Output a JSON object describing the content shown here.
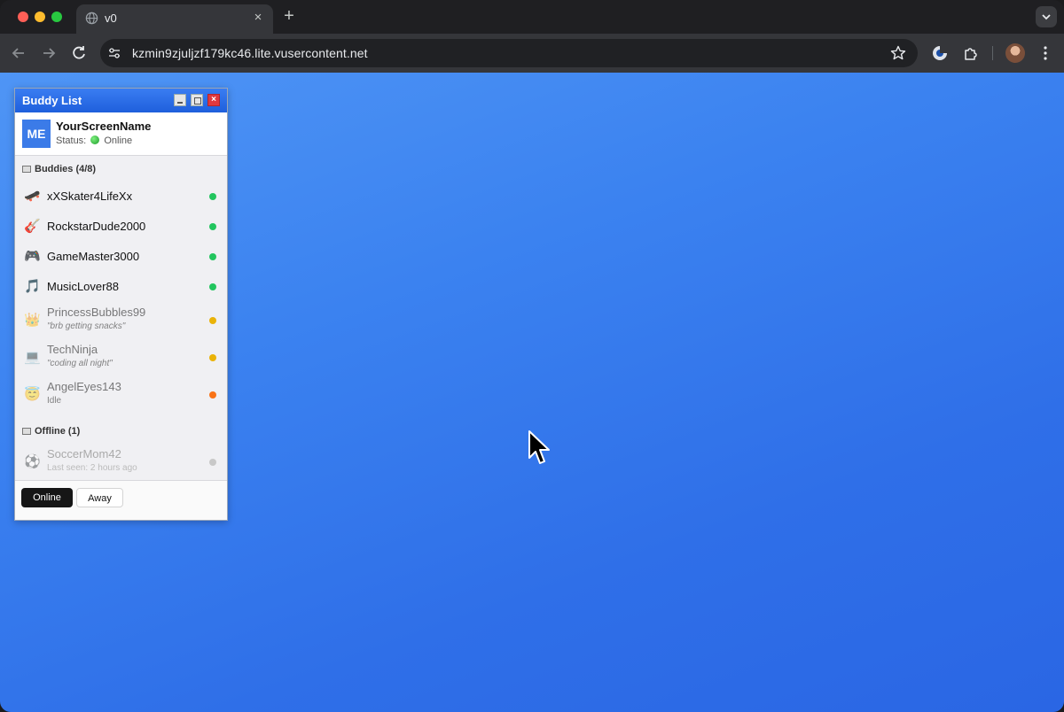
{
  "browser": {
    "tab_title": "v0",
    "tab_close": "×",
    "new_tab": "+",
    "url": "kzmin9zjuljzf179kc46.lite.vusercontent.net"
  },
  "buddy_list": {
    "title": "Buddy List",
    "close_label": "×",
    "me": {
      "avatar": "ME",
      "screen_name": "YourScreenName",
      "status_prefix": "Status:",
      "status": "Online"
    },
    "groups": {
      "buddies_label": "Buddies (4/8)",
      "offline_label": "Offline (1)"
    },
    "buddies": [
      {
        "emoji": "🛹",
        "name": "xXSkater4LifeXx",
        "status": "online",
        "color": "#22c55e"
      },
      {
        "emoji": "🎸",
        "name": "RockstarDude2000",
        "status": "online",
        "color": "#22c55e"
      },
      {
        "emoji": "🎮",
        "name": "GameMaster3000",
        "status": "online",
        "color": "#22c55e"
      },
      {
        "emoji": "🎵",
        "name": "MusicLover88",
        "status": "online",
        "color": "#22c55e"
      },
      {
        "emoji": "👑",
        "name": "PrincessBubbles99",
        "message": "\"brb getting snacks\"",
        "status": "away",
        "color": "#eab308"
      },
      {
        "emoji": "💻",
        "name": "TechNinja",
        "message": "\"coding all night\"",
        "status": "away",
        "color": "#eab308"
      },
      {
        "emoji": "😇",
        "name": "AngelEyes143",
        "message": "Idle",
        "status": "idle",
        "color": "#f97316"
      }
    ],
    "offline": [
      {
        "emoji": "⚽",
        "name": "SoccerMom42",
        "message": "Last seen: 2 hours ago",
        "status": "offline",
        "color": "#c8c8c8"
      }
    ],
    "footer": {
      "online_button": "Online",
      "away_button": "Away"
    }
  }
}
